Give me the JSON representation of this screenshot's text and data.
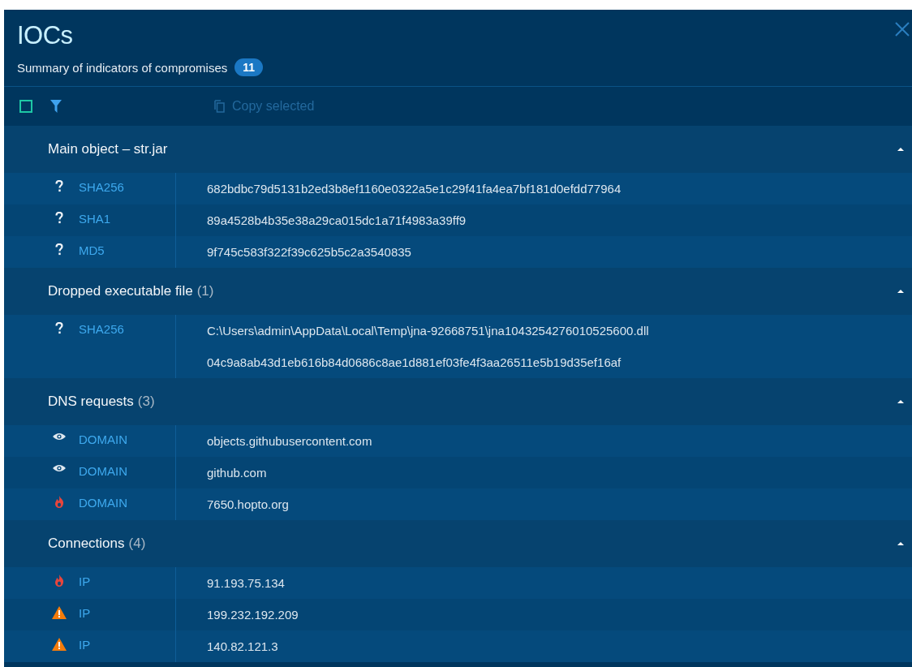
{
  "window": {
    "title": "IOCs",
    "subtitle": "Summary of indicators of compromises",
    "count": "11"
  },
  "toolbar": {
    "select_all_checked": false,
    "copy_label": "Copy selected",
    "copy_disabled": true
  },
  "sections": [
    {
      "title": "Main object – str.jar",
      "expanded": true,
      "rows": [
        {
          "kind": "unknown",
          "type": "SHA256",
          "values": [
            "682bdbc79d5131b2ed3b8ef1160e0322a5e1c29f41fa4ea7bf181d0efdd77964"
          ]
        },
        {
          "kind": "unknown",
          "type": "SHA1",
          "values": [
            "89a4528b4b35e38a29ca015dc1a71f4983a39ff9"
          ]
        },
        {
          "kind": "unknown",
          "type": "MD5",
          "values": [
            "9f745c583f322f39c625b5c2a3540835"
          ]
        }
      ]
    },
    {
      "title": "Dropped executable file",
      "count": "(1)",
      "expanded": true,
      "rows": [
        {
          "kind": "unknown",
          "type": "SHA256",
          "values": [
            "C:\\Users\\admin\\AppData\\Local\\Temp\\jna-92668751\\jna1043254276010525600.dll",
            "04c9a8ab43d1eb616b84d0686c8ae1d881ef03fe4f3aa26511e5b19d35ef16af"
          ]
        }
      ]
    },
    {
      "title": "DNS requests",
      "count": "(3)",
      "expanded": true,
      "rows": [
        {
          "kind": "eye",
          "type": "DOMAIN",
          "values": [
            "objects.githubusercontent.com"
          ]
        },
        {
          "kind": "eye",
          "type": "DOMAIN",
          "values": [
            "github.com"
          ]
        },
        {
          "kind": "fire",
          "type": "DOMAIN",
          "values": [
            "7650.hopto.org"
          ]
        }
      ]
    },
    {
      "title": "Connections",
      "count": "(4)",
      "expanded": true,
      "rows": [
        {
          "kind": "fire",
          "type": "IP",
          "values": [
            "91.193.75.134"
          ]
        },
        {
          "kind": "warning",
          "type": "IP",
          "values": [
            "199.232.192.209"
          ]
        },
        {
          "kind": "warning",
          "type": "IP",
          "values": [
            "140.82.121.3"
          ]
        }
      ]
    }
  ]
}
